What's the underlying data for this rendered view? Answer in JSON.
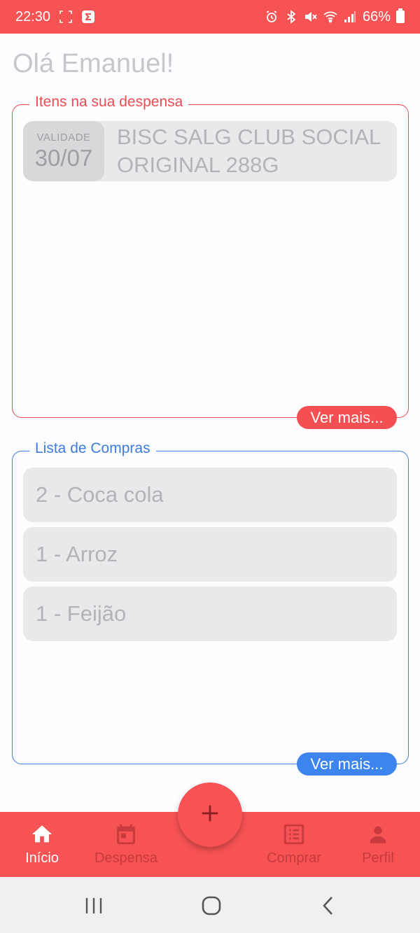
{
  "status_bar": {
    "time": "22:30",
    "battery": "66%",
    "icons": [
      "screenshot-icon",
      "app-notification-icon",
      "alarm-icon",
      "bluetooth-icon",
      "mute-icon",
      "wifi-icon",
      "signal-icon",
      "battery-icon"
    ]
  },
  "greeting": "Olá Emanuel!",
  "pantry": {
    "title": "Itens na sua despensa",
    "items": [
      {
        "validity_label": "VALIDADE",
        "date": "30/07",
        "name": "BISC SALG CLUB SOCIAL ORIGINAL 288G"
      }
    ],
    "see_more": "Ver mais...",
    "accent": "#ec4c4f"
  },
  "shopping_list": {
    "title": "Lista de Compras",
    "items": [
      {
        "label": "2 - Coca cola"
      },
      {
        "label": "1 - Arroz"
      },
      {
        "label": "1 - Feijão"
      }
    ],
    "see_more": "Ver mais...",
    "accent": "#3a7ddd"
  },
  "bottom_nav": {
    "items": [
      {
        "label": "Início",
        "icon": "home-icon",
        "active": true
      },
      {
        "label": "Despensa",
        "icon": "calendar-icon",
        "active": false
      },
      {
        "label": "Comprar",
        "icon": "list-icon",
        "active": false
      },
      {
        "label": "Perfil",
        "icon": "person-icon",
        "active": false
      }
    ],
    "fab_icon": "plus-icon",
    "background": "#f75254"
  },
  "system_nav": {
    "icons": [
      "recents-icon",
      "home-circle-icon",
      "back-icon"
    ]
  }
}
